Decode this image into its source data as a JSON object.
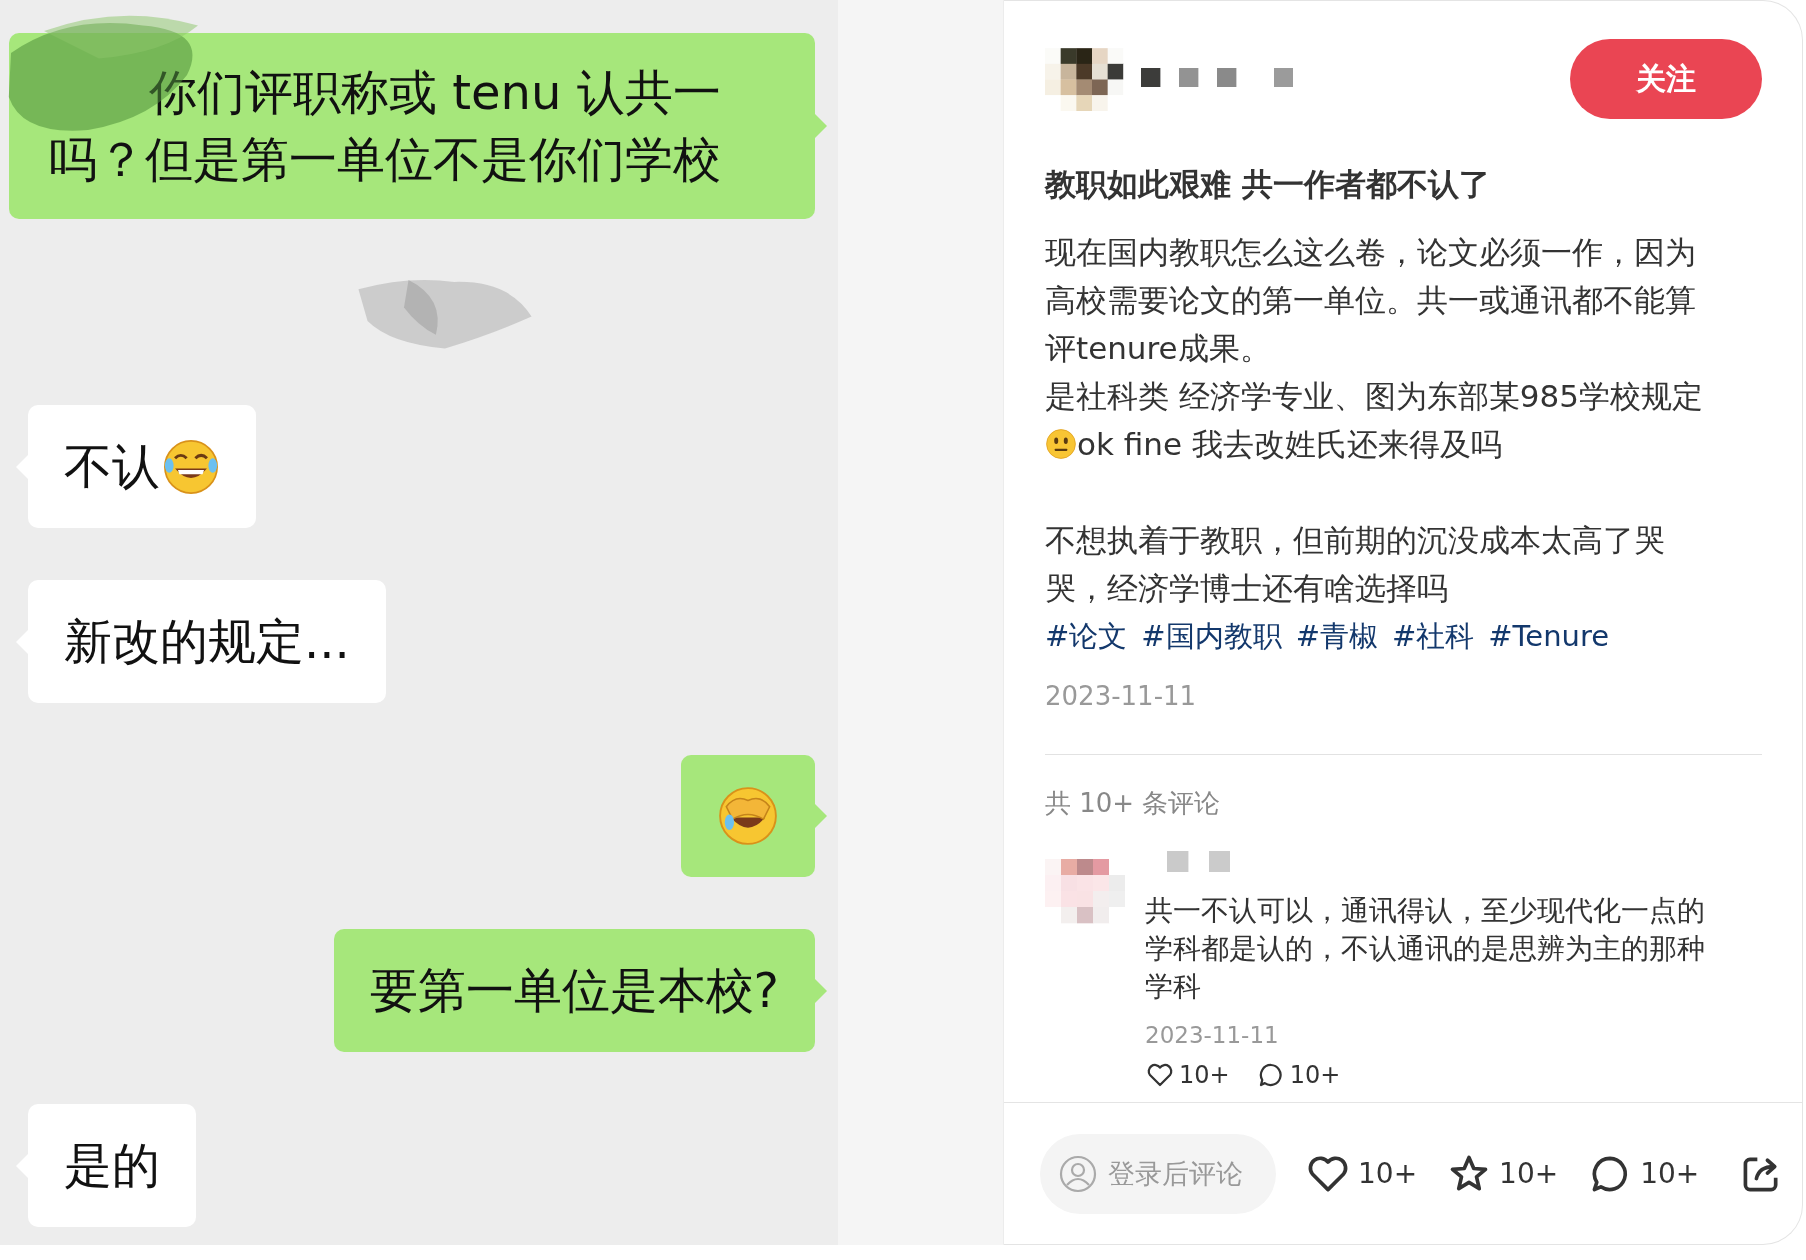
{
  "chat": {
    "messages": [
      {
        "outgoing": true,
        "kind": "text",
        "text": "你们评职称或 tenu 认共一吗？但是第一单位不是你们学校"
      },
      {
        "outgoing": false,
        "kind": "text_emoji",
        "text": "不认"
      },
      {
        "outgoing": false,
        "kind": "text",
        "text": "新改的规定..."
      },
      {
        "outgoing": true,
        "kind": "emoji"
      },
      {
        "outgoing": true,
        "kind": "text",
        "text": "要第一单位是本校?"
      },
      {
        "outgoing": false,
        "kind": "text",
        "text": "是的"
      }
    ]
  },
  "post": {
    "follow_button": "关注",
    "title": "教职如此艰难 共一作者都不认了",
    "body": [
      {
        "kind": "text",
        "text": "现在国内教职怎么这么卷，论文必须一作，因为高校需要论文的第一单位。共一或通讯都不能算评tenure成果。"
      },
      {
        "kind": "text",
        "text": "是社科类 经济学专业、图为东部某985学校规定"
      },
      {
        "kind": "emoji_text",
        "text": "ok fine 我去改姓氏还来得及吗"
      },
      {
        "kind": "blank"
      },
      {
        "kind": "text",
        "text": "不想执着于教职，但前期的沉没成本太高了哭哭，经济学博士还有啥选择吗"
      }
    ],
    "tags": [
      "#论文",
      "#国内教职",
      "#青椒",
      "#社科",
      "#Tenure"
    ],
    "date": "2023-11-11"
  },
  "comments": {
    "count_label": "共 10+ 条评论",
    "items": [
      {
        "text": "共一不认可以，通讯得认，至少现代化一点的学科都是认的，不认通讯的是思辨为主的那种学科",
        "date": "2023-11-11",
        "likes": "10+",
        "replies": "10+"
      }
    ]
  },
  "bottom_bar": {
    "comment_placeholder": "登录后评论",
    "actions": [
      {
        "kind": "like",
        "count": "10+"
      },
      {
        "kind": "collect",
        "count": "10+"
      },
      {
        "kind": "comment",
        "count": "10+"
      },
      {
        "kind": "share"
      }
    ]
  }
}
